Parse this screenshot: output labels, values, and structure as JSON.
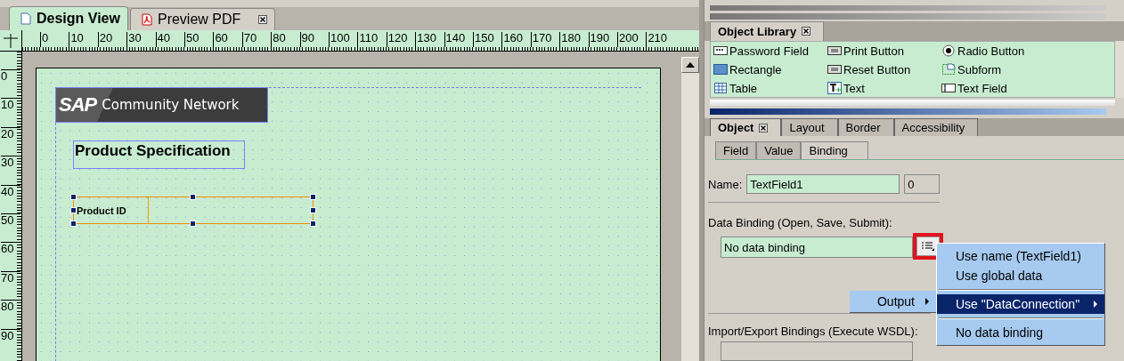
{
  "document_tabs": [
    {
      "label": "Design View",
      "selected": true,
      "closable": false
    },
    {
      "label": "Preview PDF",
      "selected": false,
      "closable": true
    }
  ],
  "ruler": {
    "horizontal": [
      "0",
      "10",
      "20",
      "30",
      "40",
      "50",
      "60",
      "70",
      "80",
      "90",
      "100",
      "110",
      "120",
      "130",
      "140",
      "150",
      "160",
      "170",
      "180",
      "190",
      "200",
      "210"
    ],
    "vertical": [
      "0",
      "10",
      "20",
      "30",
      "40",
      "50",
      "60",
      "70",
      "80",
      "90"
    ]
  },
  "canvas": {
    "logo": {
      "brand": "SAP",
      "text": "Community Network"
    },
    "heading": "Product Specification",
    "text_field": {
      "caption": "Product ID",
      "selected": true
    }
  },
  "object_library": {
    "title": "Object Library",
    "items": [
      {
        "label": "Password Field"
      },
      {
        "label": "Print Button"
      },
      {
        "label": "Radio Button"
      },
      {
        "label": "Rectangle"
      },
      {
        "label": "Reset Button"
      },
      {
        "label": "Subform"
      },
      {
        "label": "Table"
      },
      {
        "label": "Text"
      },
      {
        "label": "Text Field"
      }
    ]
  },
  "palette_tabs": [
    {
      "label": "Object",
      "selected": true,
      "closable": true
    },
    {
      "label": "Layout",
      "selected": false,
      "closable": false
    },
    {
      "label": "Border",
      "selected": false,
      "closable": false
    },
    {
      "label": "Accessibility",
      "selected": false,
      "closable": false
    }
  ],
  "sub_tabs": [
    {
      "label": "Field",
      "selected": false
    },
    {
      "label": "Value",
      "selected": false
    },
    {
      "label": "Binding",
      "selected": true
    }
  ],
  "binding": {
    "name_label": "Name:",
    "name_value": "TextField1",
    "index": "0",
    "data_binding_label": "Data Binding (Open, Save, Submit):",
    "data_binding_value": "No data binding",
    "button_highlighted": true,
    "import_export_label": "Import/Export Bindings (Execute WSDL):"
  },
  "context_menu": {
    "parent_item": "Output",
    "items": [
      {
        "kind": "item",
        "label": "Use name (TextField1)",
        "selected": false,
        "has_submenu": false
      },
      {
        "kind": "item",
        "label": "Use global data",
        "selected": false,
        "has_submenu": false
      },
      {
        "kind": "separator"
      },
      {
        "kind": "item",
        "label": "Use \"DataConnection\"",
        "selected": true,
        "has_submenu": true
      },
      {
        "kind": "separator"
      },
      {
        "kind": "item",
        "label": "No data binding",
        "selected": false,
        "has_submenu": false
      }
    ]
  }
}
